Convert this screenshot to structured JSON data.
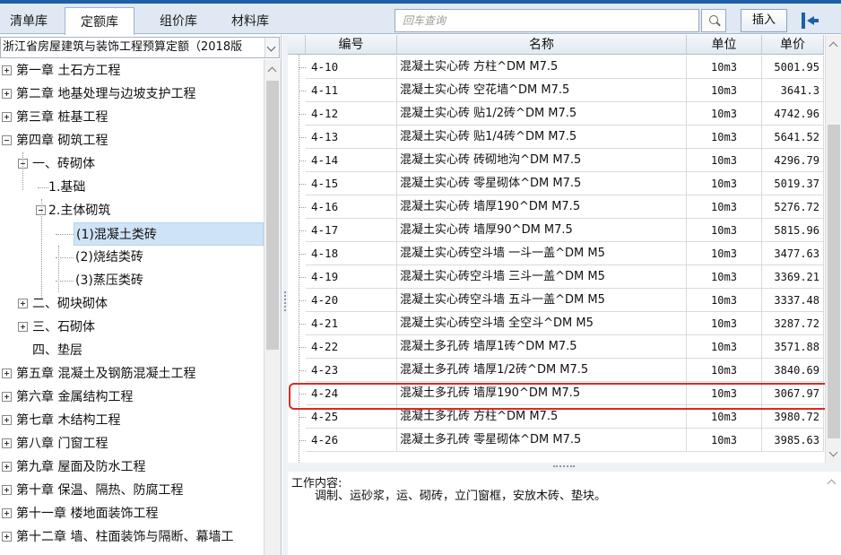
{
  "tabs": [
    {
      "label": "清单库",
      "active": false
    },
    {
      "label": "定额库",
      "active": true
    },
    {
      "label": "组价库",
      "active": false
    },
    {
      "label": "材料库",
      "active": false
    }
  ],
  "search": {
    "placeholder": "回车查询"
  },
  "toolbar": {
    "insert_label": "插入"
  },
  "library": {
    "selected": "浙江省房屋建筑与装饰工程预算定额（2018版"
  },
  "tree": {
    "items": [
      {
        "label": "第一章 土石方工程",
        "level": 0,
        "expander": "plus"
      },
      {
        "label": "第二章 地基处理与边坡支护工程",
        "level": 0,
        "expander": "plus"
      },
      {
        "label": "第三章 桩基工程",
        "level": 0,
        "expander": "plus"
      },
      {
        "label": "第四章 砌筑工程",
        "level": 0,
        "expander": "minus"
      },
      {
        "label": "一、砖砌体",
        "level": 1,
        "expander": "minus"
      },
      {
        "label": "1.基础",
        "level": 2,
        "expander": "none"
      },
      {
        "label": "2.主体砌筑",
        "level": 2,
        "expander": "minus"
      },
      {
        "label": "(1)混凝土类砖",
        "level": 3,
        "expander": "none",
        "selected": true
      },
      {
        "label": "(2)烧结类砖",
        "level": 3,
        "expander": "none"
      },
      {
        "label": "(3)蒸压类砖",
        "level": 3,
        "expander": "none"
      },
      {
        "label": "二、砌块砌体",
        "level": 1,
        "expander": "plus"
      },
      {
        "label": "三、石砌体",
        "level": 1,
        "expander": "plus"
      },
      {
        "label": "四、垫层",
        "level": 1,
        "expander": "none"
      },
      {
        "label": "第五章 混凝土及钢筋混凝土工程",
        "level": 0,
        "expander": "plus"
      },
      {
        "label": "第六章 金属结构工程",
        "level": 0,
        "expander": "plus"
      },
      {
        "label": "第七章 木结构工程",
        "level": 0,
        "expander": "plus"
      },
      {
        "label": "第八章 门窗工程",
        "level": 0,
        "expander": "plus"
      },
      {
        "label": "第九章 屋面及防水工程",
        "level": 0,
        "expander": "plus"
      },
      {
        "label": "第十章 保温、隔热、防腐工程",
        "level": 0,
        "expander": "plus"
      },
      {
        "label": "第十一章 楼地面装饰工程",
        "level": 0,
        "expander": "plus"
      },
      {
        "label": "第十二章 墙、柱面装饰与隔断、幕墙工",
        "level": 0,
        "expander": "plus"
      }
    ]
  },
  "grid": {
    "headers": {
      "code": "编号",
      "name": "名称",
      "unit": "单位",
      "price": "单价"
    },
    "rows": [
      {
        "code": "4-10",
        "name": "混凝土实心砖 方柱^DM M7.5",
        "unit": "10m3",
        "price": "5001.95"
      },
      {
        "code": "4-11",
        "name": "混凝土实心砖 空花墙^DM M7.5",
        "unit": "10m3",
        "price": "3641.3"
      },
      {
        "code": "4-12",
        "name": "混凝土实心砖 贴1/2砖^DM M7.5",
        "unit": "10m3",
        "price": "4742.96"
      },
      {
        "code": "4-13",
        "name": "混凝土实心砖 贴1/4砖^DM M7.5",
        "unit": "10m3",
        "price": "5641.52"
      },
      {
        "code": "4-14",
        "name": "混凝土实心砖 砖砌地沟^DM M7.5",
        "unit": "10m3",
        "price": "4296.79"
      },
      {
        "code": "4-15",
        "name": "混凝土实心砖 零星砌体^DM M7.5",
        "unit": "10m3",
        "price": "5019.37"
      },
      {
        "code": "4-16",
        "name": "混凝土实心砖 墙厚190^DM M7.5",
        "unit": "10m3",
        "price": "5276.72"
      },
      {
        "code": "4-17",
        "name": "混凝土实心砖 墙厚90^DM M7.5",
        "unit": "10m3",
        "price": "5815.96"
      },
      {
        "code": "4-18",
        "name": "混凝土实心砖空斗墙 一斗一盖^DM M5",
        "unit": "10m3",
        "price": "3477.63"
      },
      {
        "code": "4-19",
        "name": "混凝土实心砖空斗墙 三斗一盖^DM M5",
        "unit": "10m3",
        "price": "3369.21"
      },
      {
        "code": "4-20",
        "name": "混凝土实心砖空斗墙 五斗一盖^DM M5",
        "unit": "10m3",
        "price": "3337.48"
      },
      {
        "code": "4-21",
        "name": "混凝土实心砖空斗墙 全空斗^DM M5",
        "unit": "10m3",
        "price": "3287.72"
      },
      {
        "code": "4-22",
        "name": "混凝土多孔砖 墙厚1砖^DM M7.5",
        "unit": "10m3",
        "price": "3571.88"
      },
      {
        "code": "4-23",
        "name": "混凝土多孔砖 墙厚1/2砖^DM M7.5",
        "unit": "10m3",
        "price": "3840.69"
      },
      {
        "code": "4-24",
        "name": "混凝土多孔砖 墙厚190^DM M7.5",
        "unit": "10m3",
        "price": "3067.97",
        "highlighted": true
      },
      {
        "code": "4-25",
        "name": "混凝土多孔砖 方柱^DM M7.5",
        "unit": "10m3",
        "price": "3980.72"
      },
      {
        "code": "4-26",
        "name": "混凝土多孔砖 零星砌体^DM M7.5",
        "unit": "10m3",
        "price": "3985.63"
      }
    ]
  },
  "work_content": {
    "label": "工作内容:",
    "text": "调制、运砂浆，运、砌砖，立门窗框，安放木砖、垫块。"
  },
  "colors": {
    "accent": "#1e5fa8",
    "highlight_border": "#e0281f",
    "selected_bg": "#cfe3f7"
  },
  "icons": [
    "search-icon",
    "insert-to-left-icon",
    "chevron-down-icon",
    "expand-plus-icon",
    "collapse-minus-icon",
    "scroll-up-icon",
    "scroll-down-icon"
  ]
}
